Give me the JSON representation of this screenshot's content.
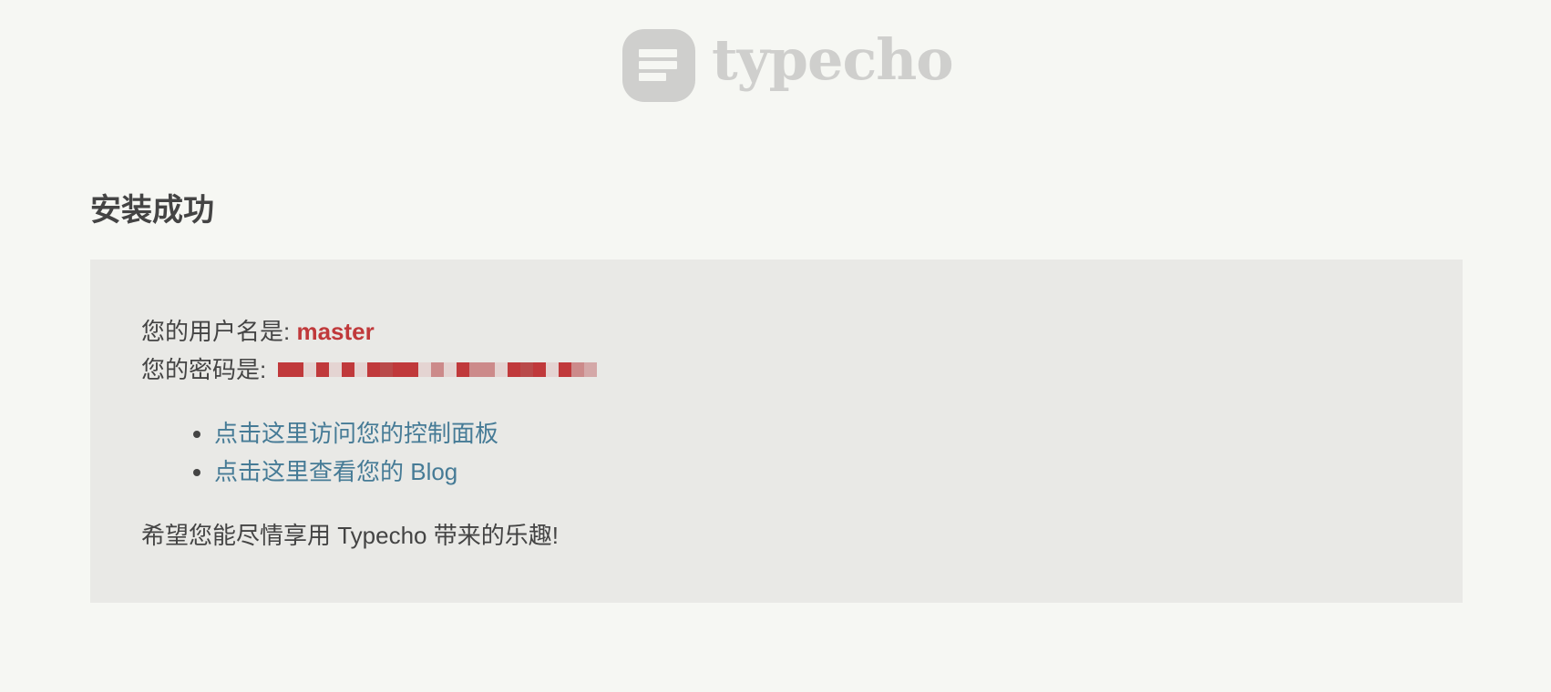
{
  "header": {
    "logo_text": "typecho"
  },
  "page": {
    "title": "安装成功"
  },
  "message": {
    "username_label": "您的用户名是: ",
    "username_value": "master",
    "password_label": "您的密码是: ",
    "password_redacted_colors": [
      "#c0393b",
      "#c0393b",
      "#e4d4d2",
      "#c0393b",
      "#e4d4d2",
      "#c0393b",
      "#e4d4d2",
      "#c0393b",
      "#b94a4a",
      "#c0393b",
      "#c0393b",
      "#e4d4d2",
      "#cc8a8a",
      "#e4d4d2",
      "#c0393b",
      "#cc8a8a",
      "#cc8a8a",
      "#e4d4d2",
      "#c0393b",
      "#b94a4a",
      "#c0393b",
      "#e4d4d2",
      "#c0393b",
      "#cc8a8a",
      "#d4a8a8"
    ],
    "links": [
      {
        "label": "点击这里访问您的控制面板"
      },
      {
        "label": "点击这里查看您的 Blog"
      }
    ],
    "closing_text": "希望您能尽情享用 Typecho 带来的乐趣!"
  },
  "colors": {
    "background": "#f6f7f3",
    "box_background": "#e9e9e6",
    "accent_red": "#c0393b",
    "link_blue": "#467b96",
    "logo_gray": "#cfcfcd"
  }
}
